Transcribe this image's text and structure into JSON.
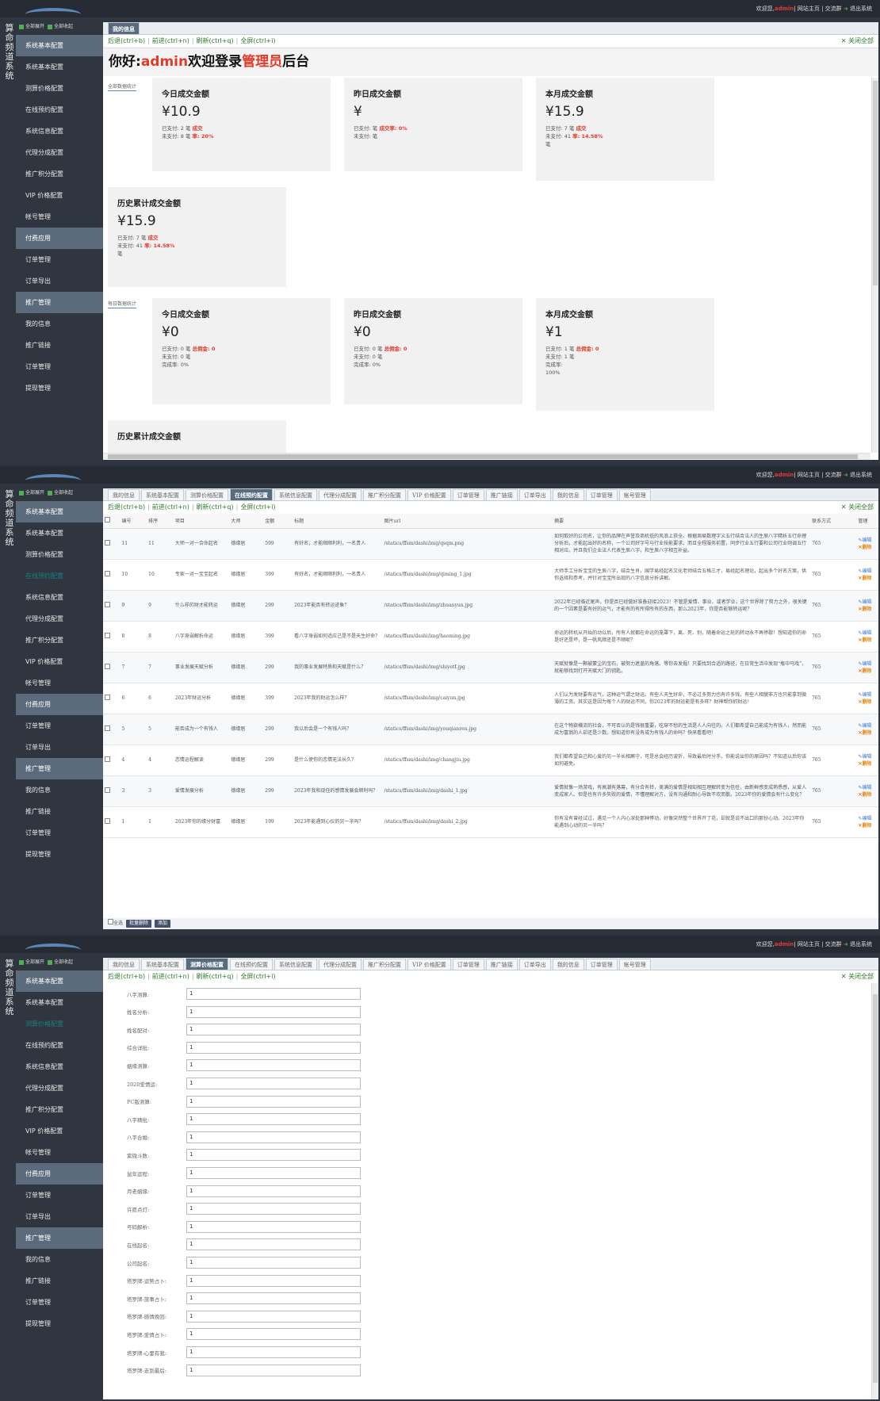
{
  "header": {
    "welcome": "欢迎您,",
    "user": "admin",
    "links": "| 网站主页 | 交流群",
    "logout": "退出系统"
  },
  "sidebar": {
    "title": [
      "算",
      "命",
      "频",
      "道",
      "系",
      "统"
    ],
    "expand_all": "全部展开",
    "collapse_all": "全部收起",
    "items": [
      {
        "label": "系统基本配置",
        "group": true
      },
      {
        "label": "系统基本配置"
      },
      {
        "label": "测算价格配置"
      },
      {
        "label": "在线预约配置"
      },
      {
        "label": "系统信息配置"
      },
      {
        "label": "代理分成配置"
      },
      {
        "label": "推广积分配置"
      },
      {
        "label": "VIP 价格配置"
      },
      {
        "label": "帐号管理"
      },
      {
        "label": "付费应用",
        "group": true
      },
      {
        "label": "订单管理"
      },
      {
        "label": "订单导出"
      },
      {
        "label": "推广管理",
        "group": true
      },
      {
        "label": "我的信息"
      },
      {
        "label": "推广链接"
      },
      {
        "label": "订单管理"
      },
      {
        "label": "提现管理"
      }
    ]
  },
  "toolbar": {
    "back": "后退(ctrl+b)",
    "forward": "前进(ctrl+n)",
    "refresh": "刷新(ctrl+q)",
    "fullscreen": "全屏(ctrl+i)",
    "close_all": "关闭全部"
  },
  "tabs_all": [
    "我的信息",
    "系统基本配置",
    "测算价格配置",
    "在线预约配置",
    "系统信息配置",
    "代理分成配置",
    "推广积分配置",
    "VIP 价格配置",
    "订单管理",
    "推广链接",
    "订单导出",
    "我的信息",
    "订单管理",
    "帐号管理"
  ],
  "panel1": {
    "tab": "我的信息",
    "greeting": {
      "prefix": "你好:",
      "user": "admin",
      "mid": "欢迎登录",
      "role": "管理员",
      "suffix": "后台"
    },
    "section_all": "全部数据统计",
    "section_daily": "每日数据统计",
    "all_stats": [
      {
        "title": "今日成交金额",
        "amount": "¥10.9",
        "l1a": "已支付: 2 笔",
        "l1b": "成交",
        "l2a": "未支付: 8 笔",
        "l2b": "率: 20%",
        "l3": ""
      },
      {
        "title": "昨日成交金额",
        "amount": "¥",
        "l1a": "已支付: 笔",
        "l1b": "成交率: 0%",
        "l2a": "未支付: 笔",
        "l2b": "",
        "l3": ""
      },
      {
        "title": "本月成交金额",
        "amount": "¥15.9",
        "l1a": "已支付: 7 笔",
        "l1b": "成交",
        "l2a": "未支付: 41",
        "l2b": "率: 14.58%",
        "l3": "笔"
      },
      {
        "title": "历史累计成交金额",
        "amount": "¥15.9",
        "l1a": "已支付: 7 笔",
        "l1b": "成交",
        "l2a": "未支付: 41",
        "l2b": "率: 14.58%",
        "l3": "笔"
      }
    ],
    "daily_stats": [
      {
        "title": "今日成交金额",
        "amount": "¥0",
        "l1a": "已支付: 0 笔",
        "l1b": "总佣金: 0",
        "l2a": "未支付: 0 笔",
        "l3": "完成率: 0%"
      },
      {
        "title": "昨日成交金额",
        "amount": "¥0",
        "l1a": "已支付: 0 笔",
        "l1b": "总佣金: 0",
        "l2a": "未支付: 0 笔",
        "l3": "完成率: 0%"
      },
      {
        "title": "本月成交金额",
        "amount": "¥1",
        "l1a": "已支付: 1 笔",
        "l1b": "总佣金: 0",
        "l2a": "未支付: 1 笔",
        "l3": "完成率:",
        "l4": "100%"
      },
      {
        "title": "历史累计成交金额"
      }
    ]
  },
  "panel2": {
    "active_tab": "在线预约配置",
    "columns": [
      "编号",
      "排序",
      "项目",
      "大师",
      "金额",
      "标题",
      "图片url",
      "摘要",
      "联系方式",
      "管理"
    ],
    "rows": [
      {
        "id": "11",
        "sort": "11",
        "item": "大师一对一合命起名",
        "master": "德缘居",
        "price": "599",
        "title": "有好名，才能顺顺利利，一名贵人",
        "url": "/statics/ffsm/dashi/img/qsqm.png",
        "desc": "如何取好的公司名，让你的品牌在声誉及商机低的风浪上获全。根据周易数理字义五行结合法人的生辰八字精析五行命理分析后，才能起出好的名称，一个公司好字号与行业技能要求，而且全程服务前置，同步行业五行要和公司行业则调五行相对应。并且我们企业法人代表生辰八字，和生辰八字相互补益。",
        "contact": "765"
      },
      {
        "id": "10",
        "sort": "10",
        "item": "专家一对一宝宝起名",
        "master": "德缘居",
        "price": "399",
        "title": "有好名，才能顺顺利利，一名贵人",
        "url": "/statics/ffsm/dashi/img/qiming_1.jpg",
        "desc": "大师手工分析宝宝的生辰八字，结合生肖，国学易经起名文化老师结合五格三才，易经起名理论，起出多个好名方案，供你选择和参考，并针对宝宝所出现的八字信息分析讲解。",
        "contact": "765"
      },
      {
        "id": "9",
        "sort": "9",
        "item": "什么样的财才能转运",
        "master": "德缘居",
        "price": "299",
        "title": "2023年能否有转运迹象？",
        "url": "/statics/ffsm/dashi/img/zhuanyun.jpg",
        "desc": "2022年已经临近尾声，你是否已经做好准备迎接2023！不管是爱情、事业、或者学业，这个世界除了努力之外，很关键的一个因素是要有好的运气，才能有的有所得所有的东西，那么2023年，你是否能够转运呢？",
        "contact": "765"
      },
      {
        "id": "8",
        "sort": "8",
        "item": "八字身弱解析命运",
        "master": "德缘居",
        "price": "399",
        "title": "看八字身弱如何适应己是不是天生好命？",
        "url": "/statics/ffsm/dashi/img/haoming.jpg",
        "desc": "命运的转机从开始的动以后，所有人就都在命运的笼罩下，离、死、别，随着命运之轮的转动永不再停歇！想知道你的命是好还是坏，是一帆风顺还是不顺呢？",
        "contact": "765"
      },
      {
        "id": "7",
        "sort": "7",
        "item": "事业发展天赋分析",
        "master": "德缘居",
        "price": "299",
        "title": "我的事业发展特质和天赋是什么？",
        "url": "/statics/ffsm/dashi/img/shiyetf.jpg",
        "desc": "天赋就像是一颗被蒙尘的宝石，被努力遮盖的角落。等你去发掘！只要找到合适的路径，在日常生活中发现“瓶中马戏”，就能够找到打开天赋大门的钥匙。",
        "contact": "765"
      },
      {
        "id": "6",
        "sort": "6",
        "item": "2023年财运分析",
        "master": "德缘居",
        "price": "399",
        "title": "2023年我的财运怎么样？",
        "url": "/statics/ffsm/dashi/img/caiyun.jpg",
        "desc": "人们认为发财要有运气，这种运气谓之财运。有些人天生好命，不必过多努力也有许多钱，有些人相貌非方也只能拿到微薄的工资。其实这是因为每个人的财运不同，你2023年的财运能是有多旺？财神帮你抓财运！",
        "contact": "765"
      },
      {
        "id": "5",
        "sort": "5",
        "item": "能否成为一个有钱人",
        "master": "德缘居",
        "price": "299",
        "title": "我以后会是一个有钱人吗？",
        "url": "/statics/ffsm/dashi/img/youqianren.jpg",
        "desc": "在这个物欲横流的社会，不可否认的是钱很重要，吃穿不愁的生活是人人向往的。人们都希望自己能成为有钱人，然而能成为富翁的人却还是少数。想知道你有没有成为有钱人的命吗？快来看看吧！",
        "contact": "765"
      },
      {
        "id": "4",
        "sort": "4",
        "item": "恋情运程解读",
        "master": "德缘居",
        "price": "299",
        "title": "是什么使你的恋情无法长久？",
        "url": "/statics/ffsm/dashi/img/changjiu.jpg",
        "desc": "我们都希望自己和心爱的另一半长相厮守，可是总会经历波折，导致最后时分手。你能说出你的原因吗？不知道以后你该如何避免。",
        "contact": "765"
      },
      {
        "id": "3",
        "sort": "3",
        "item": "爱情发展分析",
        "master": "德缘居",
        "price": "299",
        "title": "2023年我和现任的感情发展会顺利吗？",
        "url": "/statics/ffsm/dashi/img/dashi_1.jpg",
        "desc": "爱情就像一场游戏，有高潮有落幕，有分合有转，美满的爱情是相知相互理解转变为信任，由新鲜感变成熟悉感，从爱人变成家人。但是也有许多失败的爱情，不懂理解对方，没有沟通和耐心导致不欢而散。2023年你的爱情会有什么变化？",
        "contact": "765"
      },
      {
        "id": "1",
        "sort": "1",
        "item": "2023年你的缘分财富",
        "master": "德缘居",
        "price": "199",
        "title": "2023年能遇到心仪的另一半吗？",
        "url": "/statics/ffsm/dashi/img/dashi_2.jpg",
        "desc": "你有没有曾经试过，遇见一个人内心深处那种悸动，好像突然整个世界开了花，却就是说不出口的那份心动。2023年你能遇到心动的另一半吗？",
        "contact": "765"
      }
    ],
    "ops_edit": "编辑",
    "ops_del": "删除",
    "select_all": "全选",
    "batch_delete": "批量删除",
    "add": "添加"
  },
  "panel3": {
    "active_tab": "测算价格配置",
    "fields": [
      {
        "label": "八字测算:",
        "value": "1"
      },
      {
        "label": "姓名分析:",
        "value": "1"
      },
      {
        "label": "姓名配对:",
        "value": "1"
      },
      {
        "label": "综合详批:",
        "value": "1"
      },
      {
        "label": "姻缘测算:",
        "value": "1"
      },
      {
        "label": "2020爱情运:",
        "value": "1"
      },
      {
        "label": "PC版测算:",
        "value": "1"
      },
      {
        "label": "八字精批:",
        "value": "1"
      },
      {
        "label": "八字合婚:",
        "value": "1"
      },
      {
        "label": "紫微斗数:",
        "value": "1"
      },
      {
        "label": "鼠年运程:",
        "value": "1"
      },
      {
        "label": "月老姻缘:",
        "value": "1"
      },
      {
        "label": "许愿点灯:",
        "value": "1"
      },
      {
        "label": "号码解析:",
        "value": "1"
      },
      {
        "label": "在线起名:",
        "value": "1"
      },
      {
        "label": "公司起名:",
        "value": "1"
      },
      {
        "label": "塔罗牌-运势占卜:",
        "value": "1"
      },
      {
        "label": "塔罗牌-旅事占卜:",
        "value": "1"
      },
      {
        "label": "塔罗牌-感情挽回:",
        "value": "1"
      },
      {
        "label": "塔罗牌-爱情占卜:",
        "value": "1"
      },
      {
        "label": "塔罗牌-心里有我:",
        "value": "1"
      },
      {
        "label": "塔罗牌-走到最后:",
        "value": "1"
      }
    ]
  },
  "colors": {
    "sidebar_bg": "#2f3640",
    "accent_red": "#e23b2a",
    "active_tab": "#586b7e",
    "toolbar_green": "#2a7a2a"
  }
}
